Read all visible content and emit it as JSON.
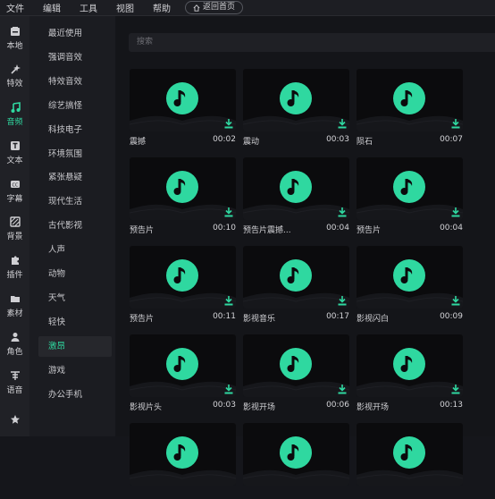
{
  "menubar": {
    "items": [
      "文件",
      "编辑",
      "工具",
      "视图",
      "帮助"
    ],
    "home_button": "返回首页"
  },
  "nav": {
    "items": [
      {
        "label": "本地",
        "icon": "folder-icon"
      },
      {
        "label": "特效",
        "icon": "magic-wand-icon"
      },
      {
        "label": "音频",
        "icon": "music-note-icon",
        "active": true
      },
      {
        "label": "文本",
        "icon": "text-icon"
      },
      {
        "label": "字幕",
        "icon": "caption-icon"
      },
      {
        "label": "背景",
        "icon": "background-icon"
      },
      {
        "label": "插件",
        "icon": "puzzle-icon"
      },
      {
        "label": "素材",
        "icon": "material-folder-icon"
      },
      {
        "label": "角色",
        "icon": "person-icon"
      },
      {
        "label": "语音",
        "icon": "voice-icon"
      },
      {
        "label": "",
        "icon": "star-icon"
      }
    ]
  },
  "categories": [
    "最近使用",
    "强调音效",
    "特效音效",
    "综艺搞怪",
    "科技电子",
    "环境氛围",
    "紧张悬疑",
    "现代生活",
    "古代影视",
    "人声",
    "动物",
    "天气",
    "轻快",
    "激昂",
    "游戏",
    "办公手机"
  ],
  "active_category": "激昂",
  "search": {
    "placeholder": "搜索"
  },
  "colors": {
    "accent": "#2fd8a0"
  },
  "audio_cards": [
    {
      "name": "震撼",
      "duration": "00:02"
    },
    {
      "name": "震动",
      "duration": "00:03"
    },
    {
      "name": "陨石",
      "duration": "00:07"
    },
    {
      "name": "预告片",
      "duration": "00:10"
    },
    {
      "name": "预告片震撼...",
      "duration": "00:04"
    },
    {
      "name": "预告片",
      "duration": "00:04"
    },
    {
      "name": "预告片",
      "duration": "00:11"
    },
    {
      "name": "影视音乐",
      "duration": "00:17"
    },
    {
      "name": "影视闪白",
      "duration": "00:09"
    },
    {
      "name": "影视片头",
      "duration": "00:03"
    },
    {
      "name": "影视开场",
      "duration": "00:06"
    },
    {
      "name": "影视开场",
      "duration": "00:13"
    }
  ]
}
